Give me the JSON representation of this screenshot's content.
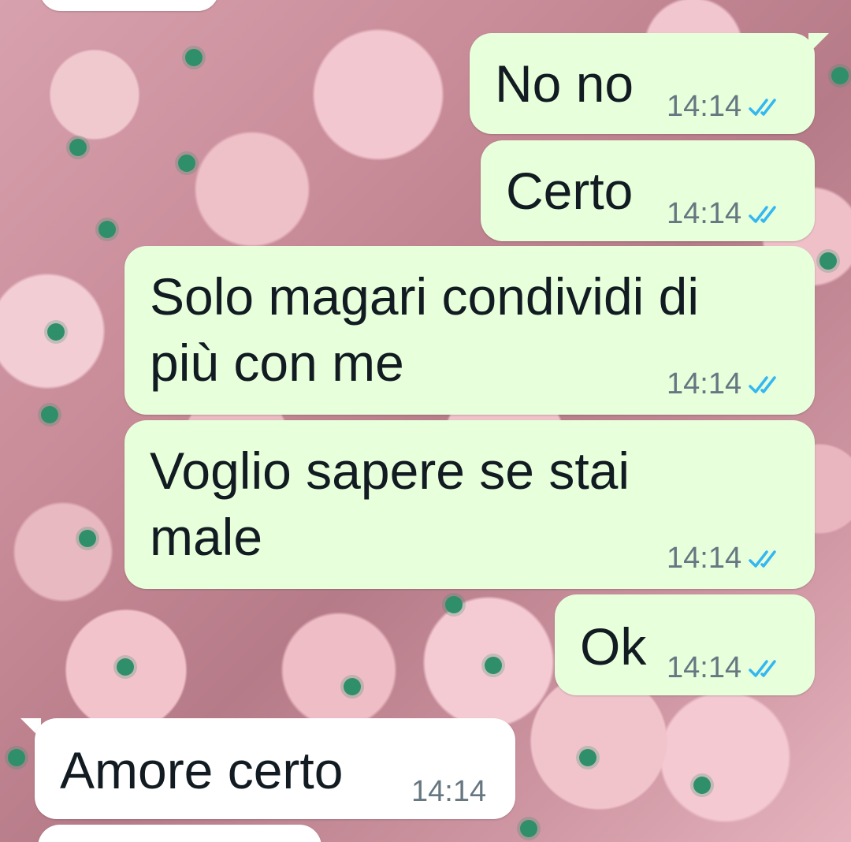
{
  "chat": {
    "messages": [
      {
        "direction": "outgoing",
        "text_lines": [
          "No no"
        ],
        "time": "14:14",
        "status_icon": "double-check-read-icon"
      },
      {
        "direction": "outgoing",
        "text_lines": [
          "Certo"
        ],
        "time": "14:14",
        "status_icon": "double-check-read-icon"
      },
      {
        "direction": "outgoing",
        "text_lines": [
          "Solo magari condividi di",
          "più con me"
        ],
        "time": "14:14",
        "status_icon": "double-check-read-icon"
      },
      {
        "direction": "outgoing",
        "text_lines": [
          "Voglio sapere se stai",
          "male"
        ],
        "time": "14:14",
        "status_icon": "double-check-read-icon"
      },
      {
        "direction": "outgoing",
        "text_lines": [
          "Ok"
        ],
        "time": "14:14",
        "status_icon": "double-check-read-icon"
      },
      {
        "direction": "incoming",
        "text_lines": [
          "Amore certo"
        ],
        "time": "14:14"
      }
    ]
  },
  "colors": {
    "outgoing_bubble": "#e7ffdb",
    "incoming_bubble": "#ffffff",
    "read_tick": "#34b7f1",
    "timestamp": "#667781",
    "text": "#111b21"
  }
}
